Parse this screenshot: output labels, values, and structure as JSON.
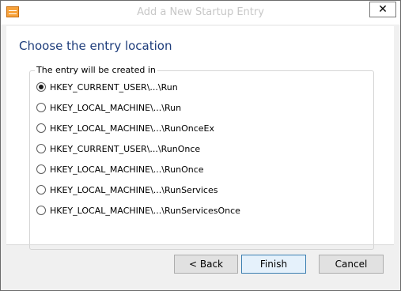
{
  "window": {
    "title": "Add a New Startup Entry",
    "close_label": "✕"
  },
  "page": {
    "heading": "Choose the entry location",
    "group_label": "The entry will be created in",
    "options": [
      {
        "label": "HKEY_CURRENT_USER\\...\\Run",
        "checked": true
      },
      {
        "label": "HKEY_LOCAL_MACHINE\\...\\Run",
        "checked": false
      },
      {
        "label": "HKEY_LOCAL_MACHINE\\...\\RunOnceEx",
        "checked": false
      },
      {
        "label": "HKEY_CURRENT_USER\\...\\RunOnce",
        "checked": false
      },
      {
        "label": "HKEY_LOCAL_MACHINE\\...\\RunOnce",
        "checked": false
      },
      {
        "label": "HKEY_LOCAL_MACHINE\\...\\RunServices",
        "checked": false
      },
      {
        "label": "HKEY_LOCAL_MACHINE\\...\\RunServicesOnce",
        "checked": false
      }
    ]
  },
  "buttons": {
    "back": "< Back",
    "finish": "Finish",
    "cancel": "Cancel"
  },
  "icons": {
    "app": "startup-manager-icon",
    "close": "close-icon"
  },
  "colors": {
    "heading": "#1e3d7b",
    "default_button_border": "#3c7fb1"
  }
}
